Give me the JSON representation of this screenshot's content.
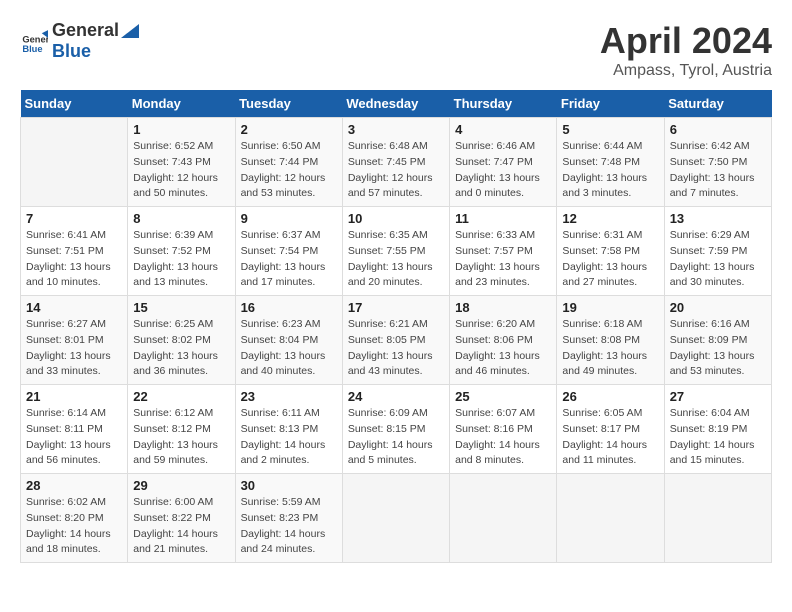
{
  "header": {
    "logo_general": "General",
    "logo_blue": "Blue",
    "month_title": "April 2024",
    "subtitle": "Ampass, Tyrol, Austria"
  },
  "days_of_week": [
    "Sunday",
    "Monday",
    "Tuesday",
    "Wednesday",
    "Thursday",
    "Friday",
    "Saturday"
  ],
  "weeks": [
    [
      {
        "day": "",
        "info": ""
      },
      {
        "day": "1",
        "info": "Sunrise: 6:52 AM\nSunset: 7:43 PM\nDaylight: 12 hours\nand 50 minutes."
      },
      {
        "day": "2",
        "info": "Sunrise: 6:50 AM\nSunset: 7:44 PM\nDaylight: 12 hours\nand 53 minutes."
      },
      {
        "day": "3",
        "info": "Sunrise: 6:48 AM\nSunset: 7:45 PM\nDaylight: 12 hours\nand 57 minutes."
      },
      {
        "day": "4",
        "info": "Sunrise: 6:46 AM\nSunset: 7:47 PM\nDaylight: 13 hours\nand 0 minutes."
      },
      {
        "day": "5",
        "info": "Sunrise: 6:44 AM\nSunset: 7:48 PM\nDaylight: 13 hours\nand 3 minutes."
      },
      {
        "day": "6",
        "info": "Sunrise: 6:42 AM\nSunset: 7:50 PM\nDaylight: 13 hours\nand 7 minutes."
      }
    ],
    [
      {
        "day": "7",
        "info": "Sunrise: 6:41 AM\nSunset: 7:51 PM\nDaylight: 13 hours\nand 10 minutes."
      },
      {
        "day": "8",
        "info": "Sunrise: 6:39 AM\nSunset: 7:52 PM\nDaylight: 13 hours\nand 13 minutes."
      },
      {
        "day": "9",
        "info": "Sunrise: 6:37 AM\nSunset: 7:54 PM\nDaylight: 13 hours\nand 17 minutes."
      },
      {
        "day": "10",
        "info": "Sunrise: 6:35 AM\nSunset: 7:55 PM\nDaylight: 13 hours\nand 20 minutes."
      },
      {
        "day": "11",
        "info": "Sunrise: 6:33 AM\nSunset: 7:57 PM\nDaylight: 13 hours\nand 23 minutes."
      },
      {
        "day": "12",
        "info": "Sunrise: 6:31 AM\nSunset: 7:58 PM\nDaylight: 13 hours\nand 27 minutes."
      },
      {
        "day": "13",
        "info": "Sunrise: 6:29 AM\nSunset: 7:59 PM\nDaylight: 13 hours\nand 30 minutes."
      }
    ],
    [
      {
        "day": "14",
        "info": "Sunrise: 6:27 AM\nSunset: 8:01 PM\nDaylight: 13 hours\nand 33 minutes."
      },
      {
        "day": "15",
        "info": "Sunrise: 6:25 AM\nSunset: 8:02 PM\nDaylight: 13 hours\nand 36 minutes."
      },
      {
        "day": "16",
        "info": "Sunrise: 6:23 AM\nSunset: 8:04 PM\nDaylight: 13 hours\nand 40 minutes."
      },
      {
        "day": "17",
        "info": "Sunrise: 6:21 AM\nSunset: 8:05 PM\nDaylight: 13 hours\nand 43 minutes."
      },
      {
        "day": "18",
        "info": "Sunrise: 6:20 AM\nSunset: 8:06 PM\nDaylight: 13 hours\nand 46 minutes."
      },
      {
        "day": "19",
        "info": "Sunrise: 6:18 AM\nSunset: 8:08 PM\nDaylight: 13 hours\nand 49 minutes."
      },
      {
        "day": "20",
        "info": "Sunrise: 6:16 AM\nSunset: 8:09 PM\nDaylight: 13 hours\nand 53 minutes."
      }
    ],
    [
      {
        "day": "21",
        "info": "Sunrise: 6:14 AM\nSunset: 8:11 PM\nDaylight: 13 hours\nand 56 minutes."
      },
      {
        "day": "22",
        "info": "Sunrise: 6:12 AM\nSunset: 8:12 PM\nDaylight: 13 hours\nand 59 minutes."
      },
      {
        "day": "23",
        "info": "Sunrise: 6:11 AM\nSunset: 8:13 PM\nDaylight: 14 hours\nand 2 minutes."
      },
      {
        "day": "24",
        "info": "Sunrise: 6:09 AM\nSunset: 8:15 PM\nDaylight: 14 hours\nand 5 minutes."
      },
      {
        "day": "25",
        "info": "Sunrise: 6:07 AM\nSunset: 8:16 PM\nDaylight: 14 hours\nand 8 minutes."
      },
      {
        "day": "26",
        "info": "Sunrise: 6:05 AM\nSunset: 8:17 PM\nDaylight: 14 hours\nand 11 minutes."
      },
      {
        "day": "27",
        "info": "Sunrise: 6:04 AM\nSunset: 8:19 PM\nDaylight: 14 hours\nand 15 minutes."
      }
    ],
    [
      {
        "day": "28",
        "info": "Sunrise: 6:02 AM\nSunset: 8:20 PM\nDaylight: 14 hours\nand 18 minutes."
      },
      {
        "day": "29",
        "info": "Sunrise: 6:00 AM\nSunset: 8:22 PM\nDaylight: 14 hours\nand 21 minutes."
      },
      {
        "day": "30",
        "info": "Sunrise: 5:59 AM\nSunset: 8:23 PM\nDaylight: 14 hours\nand 24 minutes."
      },
      {
        "day": "",
        "info": ""
      },
      {
        "day": "",
        "info": ""
      },
      {
        "day": "",
        "info": ""
      },
      {
        "day": "",
        "info": ""
      }
    ]
  ]
}
